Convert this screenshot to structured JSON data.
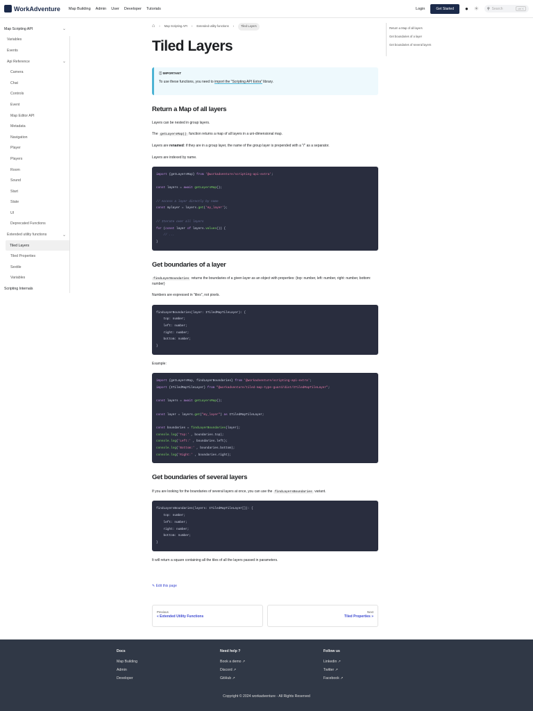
{
  "header": {
    "brand": "WorkAdventure",
    "nav": [
      "Map Building",
      "Admin",
      "User",
      "Developer",
      "Tutorials"
    ],
    "login": "Login",
    "get_started": "Get Started",
    "search_placeholder": "Search",
    "search_kbd": "ctrl K"
  },
  "sidebar": {
    "items": [
      {
        "label": "Map Scripting API",
        "level": "top",
        "chev": "⌄"
      },
      {
        "label": "Variables",
        "level": "l1"
      },
      {
        "label": "Events",
        "level": "l1"
      },
      {
        "label": "Api Reference",
        "level": "l1",
        "chev": "⌄"
      },
      {
        "label": "Camera",
        "level": "l2"
      },
      {
        "label": "Chat",
        "level": "l2"
      },
      {
        "label": "Controls",
        "level": "l2"
      },
      {
        "label": "Event",
        "level": "l2"
      },
      {
        "label": "Map Editor API",
        "level": "l2"
      },
      {
        "label": "Metadata",
        "level": "l2"
      },
      {
        "label": "Navigation",
        "level": "l2"
      },
      {
        "label": "Player",
        "level": "l2"
      },
      {
        "label": "Players",
        "level": "l2"
      },
      {
        "label": "Room",
        "level": "l2"
      },
      {
        "label": "Sound",
        "level": "l2"
      },
      {
        "label": "Start",
        "level": "l2"
      },
      {
        "label": "State",
        "level": "l2"
      },
      {
        "label": "UI",
        "level": "l2"
      },
      {
        "label": "Deprecated Functions",
        "level": "l2"
      },
      {
        "label": "Extended utility functions",
        "level": "l1",
        "chev": "⌄"
      },
      {
        "label": "Tiled Layers",
        "level": "act"
      },
      {
        "label": "Tiled Properties",
        "level": "l2"
      },
      {
        "label": "Sextile",
        "level": "l2"
      },
      {
        "label": "Variables",
        "level": "l2"
      },
      {
        "label": "Scripting Internals",
        "level": "top2"
      }
    ]
  },
  "breadcrumb": [
    "Map Scripting API",
    "Extended utility functions",
    "Tiled Layers"
  ],
  "title": "Tiled Layers",
  "important": {
    "label": "IMPORTANT",
    "text": "To use these functions, you need to ",
    "link": "import the \"Scripting API Extra\"",
    "after": " library."
  },
  "s1": {
    "heading": "Return a Map of all layers",
    "p1": "Layers can be nested in group layers.",
    "p2a": "The ",
    "p2code": "getLayersMap()",
    "p2b": " function returns a map of all layers in a uni-dimensional map.",
    "p3a": "Layers are ",
    "p3b": "renamed",
    "p3c": ": if they are in a group layer, the name of the group layer is prepended with a \"/\" as a separator.",
    "p4": "Layers are indexed by name."
  },
  "s2": {
    "heading": "Get boundaries of a layer",
    "p1code": "findLayerBoundaries",
    "p1": " returns the boundaries of a given layer as an object with properties: {top: number, left: number, right: number, bottom: number}",
    "p2": "Numbers are expressed in \"tiles\", not pixels.",
    "example": "Example:"
  },
  "s3": {
    "heading": "Get boundaries of several layers",
    "p1": "If you are looking for the boundaries of several layers at once, you can use the ",
    "p1code": "findLayersBoundaries",
    "p1b": " variant.",
    "p2": "It will return a square containing all the tiles of all the layers passed in parameters."
  },
  "code": [
    [
      [
        [
          "import",
          "kw"
        ],
        [
          " {getLayersMap} ",
          ""
        ],
        [
          "from",
          "kw"
        ],
        [
          " '@workadventure/scripting-api-extra'",
          "st"
        ],
        [
          ";",
          ""
        ]
      ],
      [],
      [
        [
          "const",
          "kw"
        ],
        [
          " layers = ",
          ""
        ],
        [
          "await",
          "kw"
        ],
        [
          " getLayersMap",
          "fn"
        ],
        [
          "();",
          ""
        ]
      ],
      [],
      [
        [
          "// Access a layer directly by name",
          "cm"
        ]
      ],
      [
        [
          "const",
          "kw"
        ],
        [
          " mylayer = layers.",
          ""
        ],
        [
          "get",
          "fn"
        ],
        [
          "(",
          ""
        ],
        [
          "'my_layer'",
          "st"
        ],
        [
          ");",
          ""
        ]
      ],
      [],
      [
        [
          "// Iterate over all layers",
          "cm"
        ]
      ],
      [
        [
          "for",
          "kw"
        ],
        [
          " (",
          ""
        ],
        [
          "const",
          "kw"
        ],
        [
          " layer ",
          ""
        ],
        [
          "of",
          "kw"
        ],
        [
          " layers.",
          ""
        ],
        [
          "values",
          "fn"
        ],
        [
          "()) {",
          ""
        ]
      ],
      [
        [
          "    // ...",
          "cm"
        ]
      ],
      [
        [
          "}",
          ""
        ]
      ]
    ],
    [
      [
        [
          "findLayerBoundaries(layer: ITiledMapTileLayer): {",
          ""
        ]
      ],
      [
        [
          "    top: number;",
          ""
        ]
      ],
      [
        [
          "    left: number;",
          ""
        ]
      ],
      [
        [
          "    right: number;",
          ""
        ]
      ],
      [
        [
          "    bottom: number;",
          ""
        ]
      ],
      [
        [
          "}",
          ""
        ]
      ]
    ],
    [
      [
        [
          "import",
          "kw"
        ],
        [
          " {getLayersMap, findLayerBoundaries} ",
          ""
        ],
        [
          "from",
          "kw"
        ],
        [
          " '@workadventure/scripting-api-extra'",
          "st"
        ],
        [
          ";",
          ""
        ]
      ],
      [
        [
          "import",
          "kw"
        ],
        [
          " {ITiledMapTileLayer} ",
          ""
        ],
        [
          "from",
          "kw"
        ],
        [
          " \"@workadventure/tiled-map-type-guard/dist/ITiledMapTileLayer\"",
          "st"
        ],
        [
          ";",
          ""
        ]
      ],
      [],
      [
        [
          "const",
          "kw"
        ],
        [
          " layers = ",
          ""
        ],
        [
          "await",
          "kw"
        ],
        [
          " getLayersMap",
          "fn"
        ],
        [
          "();",
          ""
        ]
      ],
      [],
      [
        [
          "const",
          "kw"
        ],
        [
          " layer = layers.",
          ""
        ],
        [
          "get",
          "fn"
        ],
        [
          "(",
          ""
        ],
        [
          "\"my_layer\"",
          "st"
        ],
        [
          ") ",
          ""
        ],
        [
          "as",
          "kw"
        ],
        [
          " ITiledMapTileLayer;",
          ""
        ]
      ],
      [],
      [
        [
          "const",
          "kw"
        ],
        [
          " boundaries = ",
          ""
        ],
        [
          "findLayerBoundaries",
          "fn"
        ],
        [
          "(layer);",
          ""
        ]
      ],
      [
        [
          "console.",
          "fn"
        ],
        [
          "log",
          "fn"
        ],
        [
          "(",
          ""
        ],
        [
          "'Top:'",
          "st"
        ],
        [
          " , boundaries.top);",
          ""
        ]
      ],
      [
        [
          "console.",
          "fn"
        ],
        [
          "log",
          "fn"
        ],
        [
          "(",
          ""
        ],
        [
          "'Left:'",
          "st"
        ],
        [
          " , boundaries.left);",
          ""
        ]
      ],
      [
        [
          "console.",
          "fn"
        ],
        [
          "log",
          "fn"
        ],
        [
          "(",
          ""
        ],
        [
          "'Bottom:'",
          "st"
        ],
        [
          " , boundaries.bottom);",
          ""
        ]
      ],
      [
        [
          "console.",
          "fn"
        ],
        [
          "log",
          "fn"
        ],
        [
          "(",
          ""
        ],
        [
          "'Right:'",
          "st"
        ],
        [
          " , boundaries.right);",
          ""
        ]
      ]
    ],
    [
      [
        [
          "findLayersBoundaries(layers: ITiledMapTileLayer[]): {",
          ""
        ]
      ],
      [
        [
          "    top: number;",
          ""
        ]
      ],
      [
        [
          "    left: number;",
          ""
        ]
      ],
      [
        [
          "    right: number;",
          ""
        ]
      ],
      [
        [
          "    bottom: number;",
          ""
        ]
      ],
      [
        [
          "}",
          ""
        ]
      ]
    ]
  ],
  "edit": "Edit this page",
  "pager": {
    "prev_sub": "Previous",
    "prev": "« Extended Utility Functions",
    "next_sub": "Next",
    "next": "Tiled Properties »"
  },
  "toc": [
    "Return a Map of all layers",
    "Get boundaries of a layer",
    "Get boundaries of several layers"
  ],
  "footer": {
    "cols": [
      {
        "title": "Docs",
        "links": [
          "Map Building",
          "Admin",
          "Developer"
        ]
      },
      {
        "title": "Need help ?",
        "links": [
          "Book a demo ↗",
          "Discord ↗",
          "GitHub ↗"
        ]
      },
      {
        "title": "Follow us",
        "links": [
          "Linkedin ↗",
          "Twitter ↗",
          "Facebook ↗"
        ]
      }
    ],
    "copyright": "Copyright © 2024 workadventure - All Rights Reserved"
  }
}
